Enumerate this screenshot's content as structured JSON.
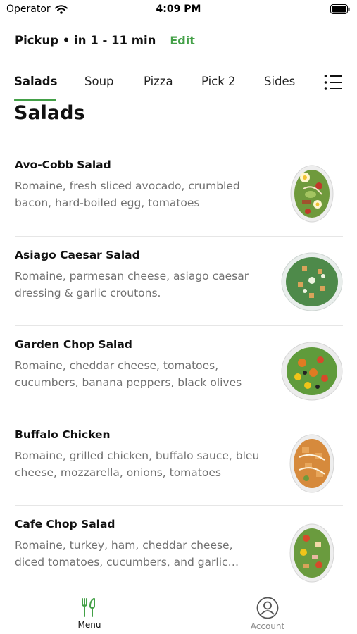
{
  "status_bar": {
    "carrier": "Operator",
    "time": "4:09 PM"
  },
  "header": {
    "pickup_text": "Pickup • in 1 - 11 min",
    "edit_label": "Edit"
  },
  "tabs": [
    {
      "label": "Salads",
      "active": true
    },
    {
      "label": "Soup",
      "active": false
    },
    {
      "label": "Pizza",
      "active": false
    },
    {
      "label": "Pick 2",
      "active": false
    },
    {
      "label": "Sides",
      "active": false
    }
  ],
  "section": {
    "title": "Salads"
  },
  "items": [
    {
      "name": "Avo-Cobb Salad",
      "description": "Romaine, fresh sliced avocado, crumbled bacon, hard-boiled egg, tomatoes"
    },
    {
      "name": "Asiago Caesar Salad",
      "description": "Romaine, parmesan cheese, asiago caesar dressing & garlic croutons."
    },
    {
      "name": "Garden Chop Salad",
      "description": "Romaine, cheddar cheese, tomatoes, cucumbers, banana peppers, black olives"
    },
    {
      "name": "Buffalo Chicken",
      "description": "Romaine, grilled chicken, buffalo sauce, bleu cheese, mozzarella, onions, tomatoes"
    },
    {
      "name": "Cafe Chop Salad",
      "description": "Romaine, turkey, ham, cheddar cheese, diced tomatoes, cucumbers, and garlic croutons"
    }
  ],
  "bottom_nav": {
    "menu_label": "Menu",
    "account_label": "Account"
  },
  "colors": {
    "accent": "#43a047",
    "muted_text": "#707070"
  }
}
